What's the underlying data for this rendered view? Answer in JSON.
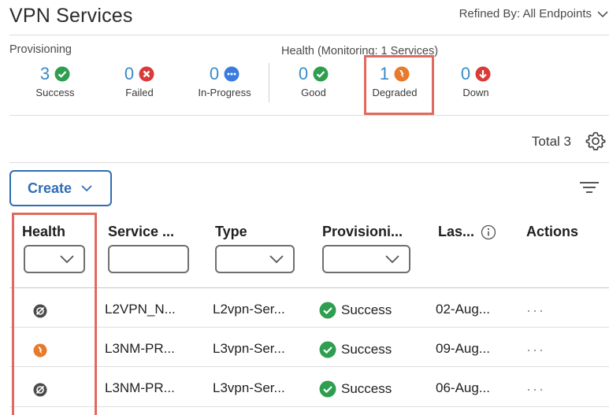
{
  "page": {
    "title": "VPN Services",
    "refined_by": "Refined By: All Endpoints"
  },
  "provisioning": {
    "label": "Provisioning",
    "stats": [
      {
        "value": "3",
        "label": "Success",
        "icon": "check-circle-icon",
        "color": "#2e9e4f"
      },
      {
        "value": "0",
        "label": "Failed",
        "icon": "x-circle-icon",
        "color": "#d93a3a"
      },
      {
        "value": "0",
        "label": "In-Progress",
        "icon": "ellipsis-circle-icon",
        "color": "#3a7be0"
      }
    ]
  },
  "health": {
    "label": "Health (Monitoring: 1 Services)",
    "stats": [
      {
        "value": "0",
        "label": "Good",
        "icon": "check-circle-icon",
        "color": "#2e9e4f"
      },
      {
        "value": "1",
        "label": "Degraded",
        "icon": "lightning-circle-icon",
        "color": "#e87a2b"
      },
      {
        "value": "0",
        "label": "Down",
        "icon": "arrow-down-circle-icon",
        "color": "#d93a3a"
      }
    ]
  },
  "toolbar": {
    "total": "Total 3",
    "create_label": "Create"
  },
  "table": {
    "columns": [
      {
        "label": "Health",
        "filter": "select"
      },
      {
        "label": "Service ...",
        "filter": "text"
      },
      {
        "label": "Type",
        "filter": "select"
      },
      {
        "label": "Provisioni...",
        "filter": "select"
      },
      {
        "label": "Las...",
        "filter": "none"
      },
      {
        "label": "Actions",
        "filter": "none"
      }
    ],
    "rows": [
      {
        "health": "unmonitored",
        "service": "L2VPN_N...",
        "type": "L2vpn-Ser...",
        "provisioning": "Success",
        "last": "02-Aug...",
        "actions": "···"
      },
      {
        "health": "degraded",
        "service": "L3NM-PR...",
        "type": "L3vpn-Ser...",
        "provisioning": "Success",
        "last": "09-Aug...",
        "actions": "···"
      },
      {
        "health": "unmonitored",
        "service": "L3NM-PR...",
        "type": "L3vpn-Ser...",
        "provisioning": "Success",
        "last": "06-Aug...",
        "actions": "···"
      }
    ]
  },
  "colors": {
    "accent": "#2f6db5",
    "number": "#3a8bc7",
    "highlight": "#e06a5f",
    "success": "#2e9e4f",
    "degraded": "#e87a2b",
    "unmonitored": "#4a4a4a"
  }
}
